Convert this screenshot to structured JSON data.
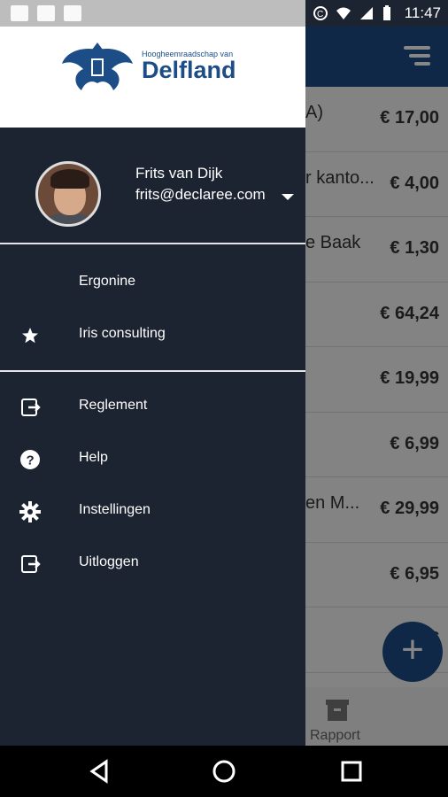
{
  "status_bar": {
    "time": "11:47"
  },
  "app": {
    "rows": [
      {
        "desc": "A)",
        "amount": "€ 17,00"
      },
      {
        "desc": "r kanto...",
        "amount": "€ 4,00"
      },
      {
        "desc": "e Baak",
        "amount": "€ 1,30"
      },
      {
        "desc": "",
        "amount": "€ 64,24"
      },
      {
        "desc": "",
        "amount": "€ 19,99"
      },
      {
        "desc": "",
        "amount": "€ 6,99"
      },
      {
        "desc": "en M...",
        "amount": "€ 29,99"
      },
      {
        "desc": "",
        "amount": "€ 6,95"
      },
      {
        "desc": "",
        "amount": "€"
      }
    ],
    "bottom_nav_label": "Rapport",
    "fab_label": "+"
  },
  "drawer": {
    "logo_small": "Hoogheemraadschap van",
    "logo_big": "Delfland",
    "user_name": "Frits van Dijk",
    "user_email": "frits@declaree.com",
    "accounts": [
      {
        "label": "Ergonine",
        "icon": ""
      },
      {
        "label": "Iris consulting",
        "icon": "star-icon"
      }
    ],
    "menu": [
      {
        "label": "Reglement",
        "icon": "exit-to-app-icon"
      },
      {
        "label": "Help",
        "icon": "help-circle-icon"
      },
      {
        "label": "Instellingen",
        "icon": "gear-icon"
      },
      {
        "label": "Uitloggen",
        "icon": "logout-icon"
      }
    ]
  },
  "colors": {
    "drawer_bg": "#1c2331",
    "brand_blue": "#1d4d86",
    "text_white": "#ffffff"
  }
}
